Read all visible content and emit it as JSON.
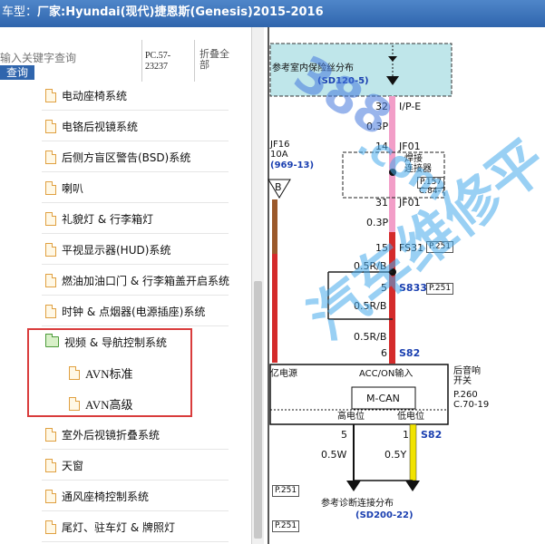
{
  "titlebar": {
    "prefix": "车型：",
    "model": "厂家:Hyundai(现代)捷恩斯(Genesis)2015-2016"
  },
  "search": {
    "placeholder": "输入关键字查询",
    "button_label": "查询",
    "part_code": "PC.57-23237",
    "fold_all_label": "折叠全部"
  },
  "tree_items": [
    {
      "label": "电动座椅系统",
      "icon": "file-icon"
    },
    {
      "label": "电铬后视镜系统",
      "icon": "file-icon"
    },
    {
      "label": "后侧方盲区警告(BSD)系统",
      "icon": "file-icon"
    },
    {
      "label": "喇叭",
      "icon": "file-icon"
    },
    {
      "label": "礼貌灯 & 行李箱灯",
      "icon": "file-icon"
    },
    {
      "label": "平视显示器(HUD)系统",
      "icon": "file-icon"
    },
    {
      "label": "燃油加油口门 & 行李箱盖开启系统",
      "icon": "file-icon"
    },
    {
      "label": "时钟 & 点烟器(电源插座)系统",
      "icon": "file-icon"
    },
    {
      "label": "视频 & 导航控制系统",
      "icon": "folder-open-icon",
      "expanded": true
    },
    {
      "label": "AVN标准",
      "icon": "file-icon",
      "child": true
    },
    {
      "label": "AVN高级",
      "icon": "file-icon",
      "child": true
    },
    {
      "label": "室外后视镜折叠系统",
      "icon": "file-icon"
    },
    {
      "label": "天窗",
      "icon": "file-icon"
    },
    {
      "label": "通风座椅控制系统",
      "icon": "file-icon"
    },
    {
      "label": "尾灯、驻车灯 & 牌照灯",
      "icon": "file-icon"
    }
  ],
  "diagram": {
    "top_ref_title": "参考室内保险丝分布",
    "top_ref_code": "(SD120-5)",
    "wire_32": "32",
    "wire_32_name": "I/P-E",
    "wire_03p_a": "0.3P",
    "wire_14": "14",
    "wire_14_name": "JF01",
    "joint_label": "焊接\n连接器",
    "ref_p157": "P.157",
    "ref_c847": "C.84-7",
    "wire_31": "31",
    "wire_31_name": "JF01",
    "wire_03p_b": "0.3P",
    "left_fuse": "JF16",
    "left_amp": "10A",
    "left_ref": "(969-13)",
    "left_b": "B",
    "wire_15": "15",
    "wire_15_name": "FS31",
    "ref_p251_a": "P.251",
    "wire_05rb_a": "0.5R/B",
    "wire_5s33": "5",
    "wire_5s33_name": "S833",
    "ref_p251_b": "P.251",
    "wire_05rb_b": "0.5R/B",
    "wire_05rb_c": "0.5R/B",
    "wire_6": "6",
    "wire_6_name": "S82",
    "module_left": "亿电源",
    "module_acc": "ACC/ON输入",
    "module_mcan": "M-CAN",
    "module_high": "高电位",
    "module_low": "低电位",
    "module_right_title": "后音响\n开关",
    "ref_p260": "P.260",
    "ref_c70": "C.70-19",
    "pin_5": "5",
    "pin_1": "1",
    "pin_1_name": "S82",
    "wire_05w": "0.5W",
    "wire_05y": "0.5Y",
    "ref_p251_c": "P.251",
    "ref_p251_d": "P.251",
    "bottom_ref_title": "参考诊断连接分布",
    "bottom_ref_code": "(SD200-22)"
  },
  "watermark": {
    "text_a": "388",
    "text_b": ".com",
    "text_c": "汽车维修平",
    "color": "#46aaeb"
  },
  "colors": {
    "highlight_border": "#d93c3c",
    "titlebar": "#2f65ad",
    "wire_pink": "#f29ec8",
    "wire_red": "#d42b2b",
    "wire_yellow": "#f1e300",
    "wire_brown": "#9b5a2c",
    "ref_box_fill": "#bfe6ea"
  }
}
